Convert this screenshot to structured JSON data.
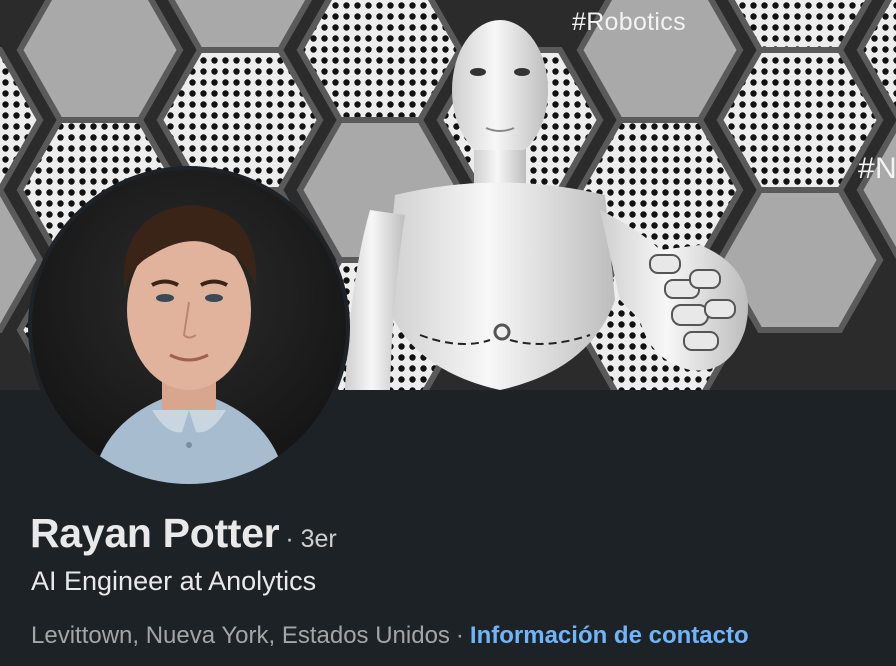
{
  "banner": {
    "hashtags": [
      "#Robotics",
      "#N"
    ]
  },
  "profile": {
    "name": "Rayan Potter",
    "degree": "· 3er",
    "headline": "AI Engineer at Anolytics",
    "location": "Levittown, Nueva York, Estados Unidos",
    "separator": "·",
    "contact_link": "Información de contacto"
  },
  "colors": {
    "background": "#1d2226",
    "name_text": "#e9e9e9",
    "secondary_text": "#a3a6a8",
    "link": "#70b5f9"
  }
}
